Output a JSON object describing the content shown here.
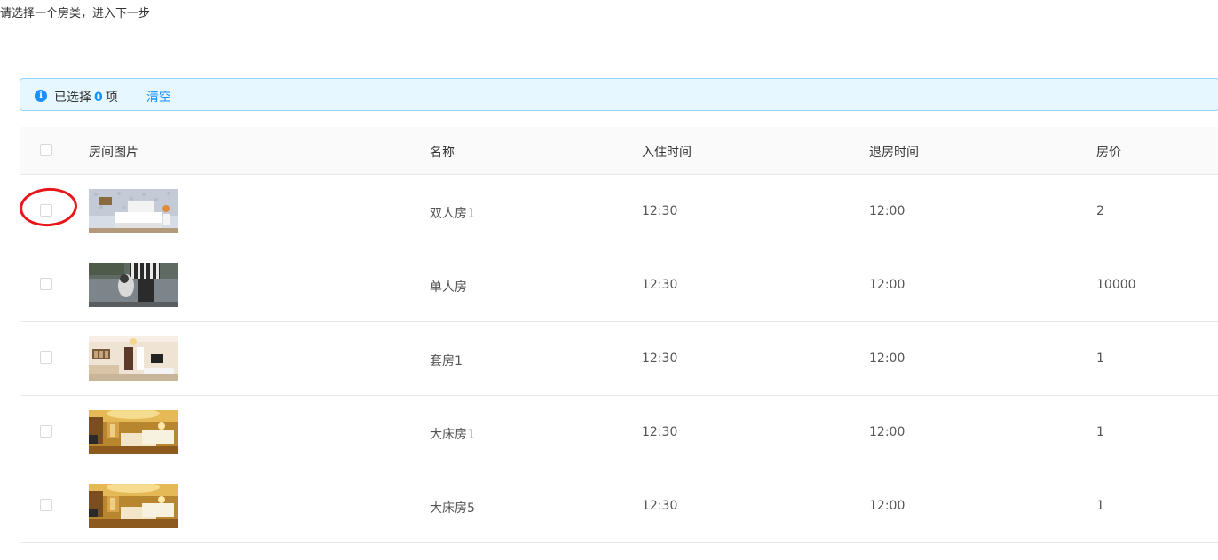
{
  "instruction": "请选择一个房类，进入下一步",
  "alert": {
    "prefix": "已选择",
    "count": "0",
    "suffix": "项",
    "clear_label": "清空"
  },
  "table": {
    "headers": {
      "image": "房间图片",
      "name": "名称",
      "checkin": "入住时间",
      "checkout": "退房时间",
      "price": "房价"
    },
    "rows": [
      {
        "name": "双人房1",
        "checkin": "12:30",
        "checkout": "12:00",
        "price": "2",
        "image": "bedroom-photo"
      },
      {
        "name": "单人房",
        "checkin": "12:30",
        "checkout": "12:00",
        "price": "10000",
        "image": "dog-photo"
      },
      {
        "name": "套房1",
        "checkin": "12:30",
        "checkout": "12:00",
        "price": "1",
        "image": "suite-photo"
      },
      {
        "name": "大床房1",
        "checkin": "12:30",
        "checkout": "12:00",
        "price": "1",
        "image": "warm-bedroom-photo"
      },
      {
        "name": "大床房5",
        "checkin": "12:30",
        "checkout": "12:00",
        "price": "1",
        "image": "warm-bedroom-photo"
      }
    ]
  },
  "colors": {
    "accent": "#1890ff",
    "alert_bg": "#e6f7ff",
    "alert_border": "#91d5ff",
    "annotation": "#e8161a"
  }
}
